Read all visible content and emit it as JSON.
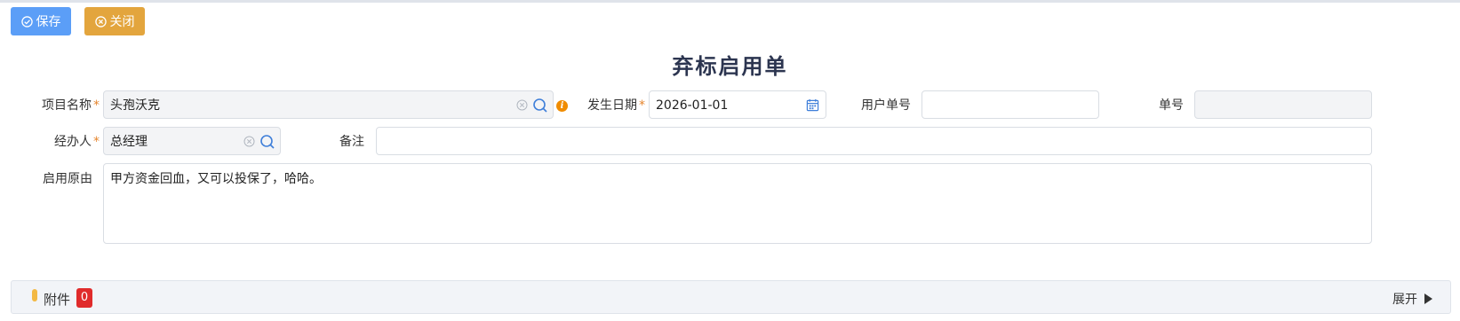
{
  "toolbar": {
    "save_label": "保存",
    "close_label": "关闭"
  },
  "form": {
    "title": "弃标启用单",
    "required_mark": "*",
    "project_name": {
      "label": "项目名称",
      "value": "头孢沃克"
    },
    "occur_date": {
      "label": "发生日期",
      "value": "2026-01-01"
    },
    "user_bill_no": {
      "label": "用户单号",
      "value": ""
    },
    "bill_no": {
      "label": "单号",
      "value": ""
    },
    "handler": {
      "label": "经办人",
      "value": "总经理"
    },
    "remark": {
      "label": "备注",
      "value": ""
    },
    "reason": {
      "label": "启用原由",
      "value": "甲方资金回血，又可以投保了，哈哈。"
    }
  },
  "attachments": {
    "label": "附件",
    "count": "0",
    "expand_label": "展开"
  },
  "colors": {
    "save_button": "#5b9ef7",
    "close_button": "#e3a53d",
    "required": "#e6862f",
    "badge": "#e02b2b"
  }
}
